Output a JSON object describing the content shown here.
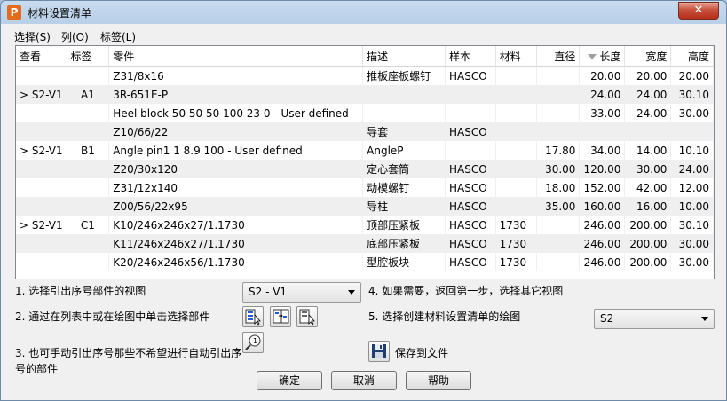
{
  "window": {
    "title": "材料设置清单",
    "app_icon": "P",
    "close_glyph": "✕"
  },
  "menu": {
    "items": [
      "选择(S)",
      "列(O)",
      "标签(L)"
    ]
  },
  "table": {
    "columns": [
      "查看",
      "标签",
      "零件",
      "描述",
      "样本",
      "材料",
      "直径",
      "长度",
      "宽度",
      "高度"
    ],
    "sorted_column": "长度",
    "rows": [
      [
        "",
        "",
        "Z31/8x16",
        "推板座板螺钉",
        "HASCO",
        "",
        "",
        "20.00",
        "20.00",
        "20.00"
      ],
      [
        "> S2-V1",
        "A1",
        "3R-651E-P",
        "",
        "",
        "",
        "",
        "24.00",
        "24.00",
        "30.10"
      ],
      [
        "",
        "",
        "Heel block 50 50 50 100 23 0 - User defined",
        "",
        "",
        "",
        "",
        "33.00",
        "24.00",
        "30.00"
      ],
      [
        "",
        "",
        "Z10/66/22",
        "导套",
        "HASCO",
        "",
        "",
        "",
        "",
        ""
      ],
      [
        "> S2-V1",
        "B1",
        "Angle pin1 1 8.9 100 - User defined",
        "AngleP",
        "",
        "",
        "17.80",
        "34.00",
        "14.00",
        "10.10"
      ],
      [
        "",
        "",
        "Z20/30x120",
        "定心套筒",
        "HASCO",
        "",
        "30.00",
        "120.00",
        "30.00",
        "24.00"
      ],
      [
        "",
        "",
        "Z31/12x140",
        "动模螺钉",
        "HASCO",
        "",
        "18.00",
        "152.00",
        "42.00",
        "12.00"
      ],
      [
        "",
        "",
        "Z00/56/22x95",
        "导柱",
        "HASCO",
        "",
        "35.00",
        "160.00",
        "16.00",
        "10.00"
      ],
      [
        "> S2-V1",
        "C1",
        "K10/246x246x27/1.1730",
        "顶部压紧板",
        "HASCO",
        "1730",
        "",
        "246.00",
        "200.00",
        "30.10"
      ],
      [
        "",
        "",
        "K11/246x246x27/1.1730",
        "底部压紧板",
        "HASCO",
        "1730",
        "",
        "246.00",
        "200.00",
        "30.00"
      ],
      [
        "",
        "",
        "K20/246x246x56/1.1730",
        "型腔板块",
        "HASCO",
        "1730",
        "",
        "246.00",
        "200.00",
        "30.00"
      ]
    ]
  },
  "steps": {
    "step1": "1. 选择引出序号部件的视图",
    "step1_value": "S2 - V1",
    "step2": "2. 通过在列表中或在绘图中单击选择部件",
    "step3_line1": "3. 也可手动引出序号那些不希望进行自动引出序",
    "step3_line2": "号的部件",
    "step4": "4. 如果需要，返回第一步，选择其它视图",
    "step5": "5. 选择创建材料设置清单的绘图",
    "step5_value": "S2",
    "save_label": "保存到文件"
  },
  "buttons": {
    "ok": "确定",
    "cancel": "取消",
    "help": "帮助"
  },
  "icons": {
    "select_all": "list-select-all-icon",
    "select_toggle": "list-select-toggle-icon",
    "select_pick": "list-select-pick-icon",
    "manual_balloon": "balloon-magnifier-icon",
    "save": "floppy-disk-icon"
  }
}
